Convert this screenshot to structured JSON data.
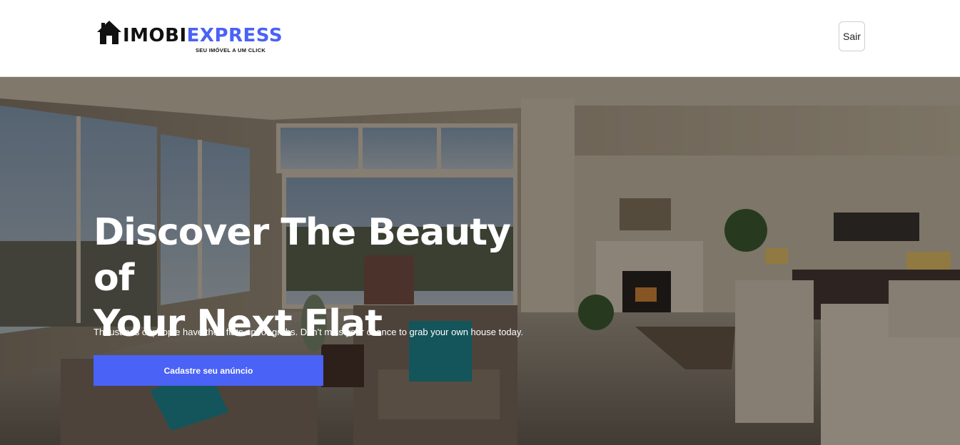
{
  "header": {
    "logo": {
      "icon": "house-icon",
      "name_part1": "IMOBI",
      "name_part2": "EXPRESS",
      "tagline": "SEU IMÓVEL A UM  CLICK"
    },
    "logout_label": "Sair"
  },
  "hero": {
    "title_line1": "Discover The Beauty of",
    "title_line2": "Your Next Flat",
    "subtitle": "Thousands of people have their flats up for grabs. Don't miss your chance to grab your own house today.",
    "cta_label": "Cadastre seu anúncio",
    "background": "living-room-photo"
  },
  "colors": {
    "accent": "#4a62f5",
    "logo_dark": "#111111",
    "header_bg": "#ffffff"
  }
}
